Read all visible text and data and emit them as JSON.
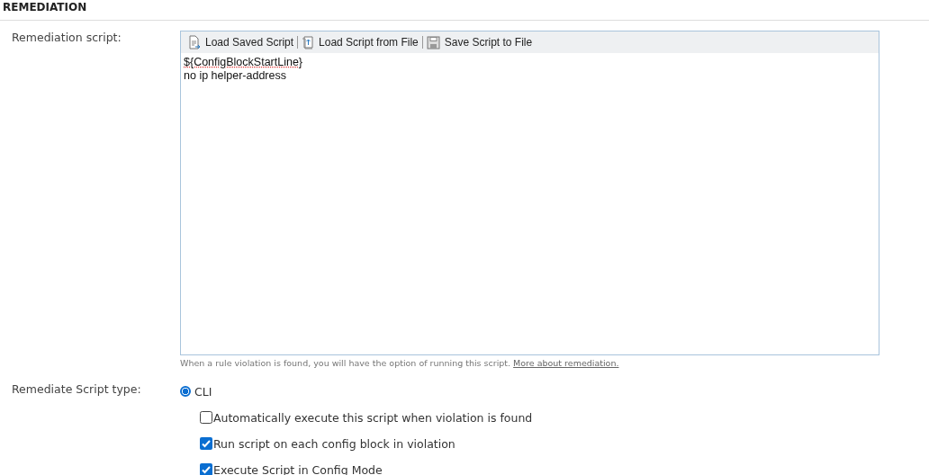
{
  "section_title": "REMEDIATION",
  "script_label": "Remediation script:",
  "toolbar": [
    {
      "kind": "load-saved",
      "label": "Load Saved Script"
    },
    {
      "kind": "load-file",
      "label": "Load Script from File"
    },
    {
      "kind": "save-file",
      "label": "Save Script to File"
    }
  ],
  "script_lines": [
    "${ConfigBlockStartLine}",
    "no ip helper-address"
  ],
  "hint": "When a rule violation is found, you will have the option of running this script.",
  "hint_link": "More about remediation.",
  "type_label": "Remediate Script type:",
  "script_types": [
    {
      "label": "CLI",
      "selected": true
    }
  ],
  "options": [
    {
      "label": "Automatically execute this script when violation is found",
      "checked": false
    },
    {
      "label": "Run script on each config block in violation",
      "checked": true
    },
    {
      "label": "Execute Script in Config Mode",
      "checked": true
    }
  ]
}
